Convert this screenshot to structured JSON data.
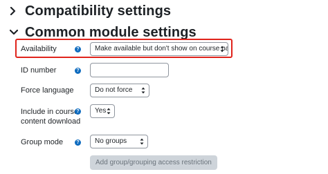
{
  "sections": {
    "compatibility": {
      "title": "Compatibility settings",
      "expanded": false
    },
    "common": {
      "title": "Common module settings",
      "expanded": true
    }
  },
  "fields": {
    "availability": {
      "label": "Availability",
      "value": "Make available but don't show on course page",
      "highlighted": true
    },
    "id_number": {
      "label": "ID number",
      "value": ""
    },
    "force_language": {
      "label": "Force language",
      "value": "Do not force"
    },
    "include_download": {
      "label_line1": "Include in course",
      "label_line2": "content download",
      "value": "Yes"
    },
    "group_mode": {
      "label": "Group mode",
      "value": "No groups"
    }
  },
  "buttons": {
    "add_restriction": "Add group/grouping access restriction"
  },
  "icons": {
    "help": "?",
    "help_color": "#0f6cbf",
    "highlight_color": "#e0231b"
  }
}
